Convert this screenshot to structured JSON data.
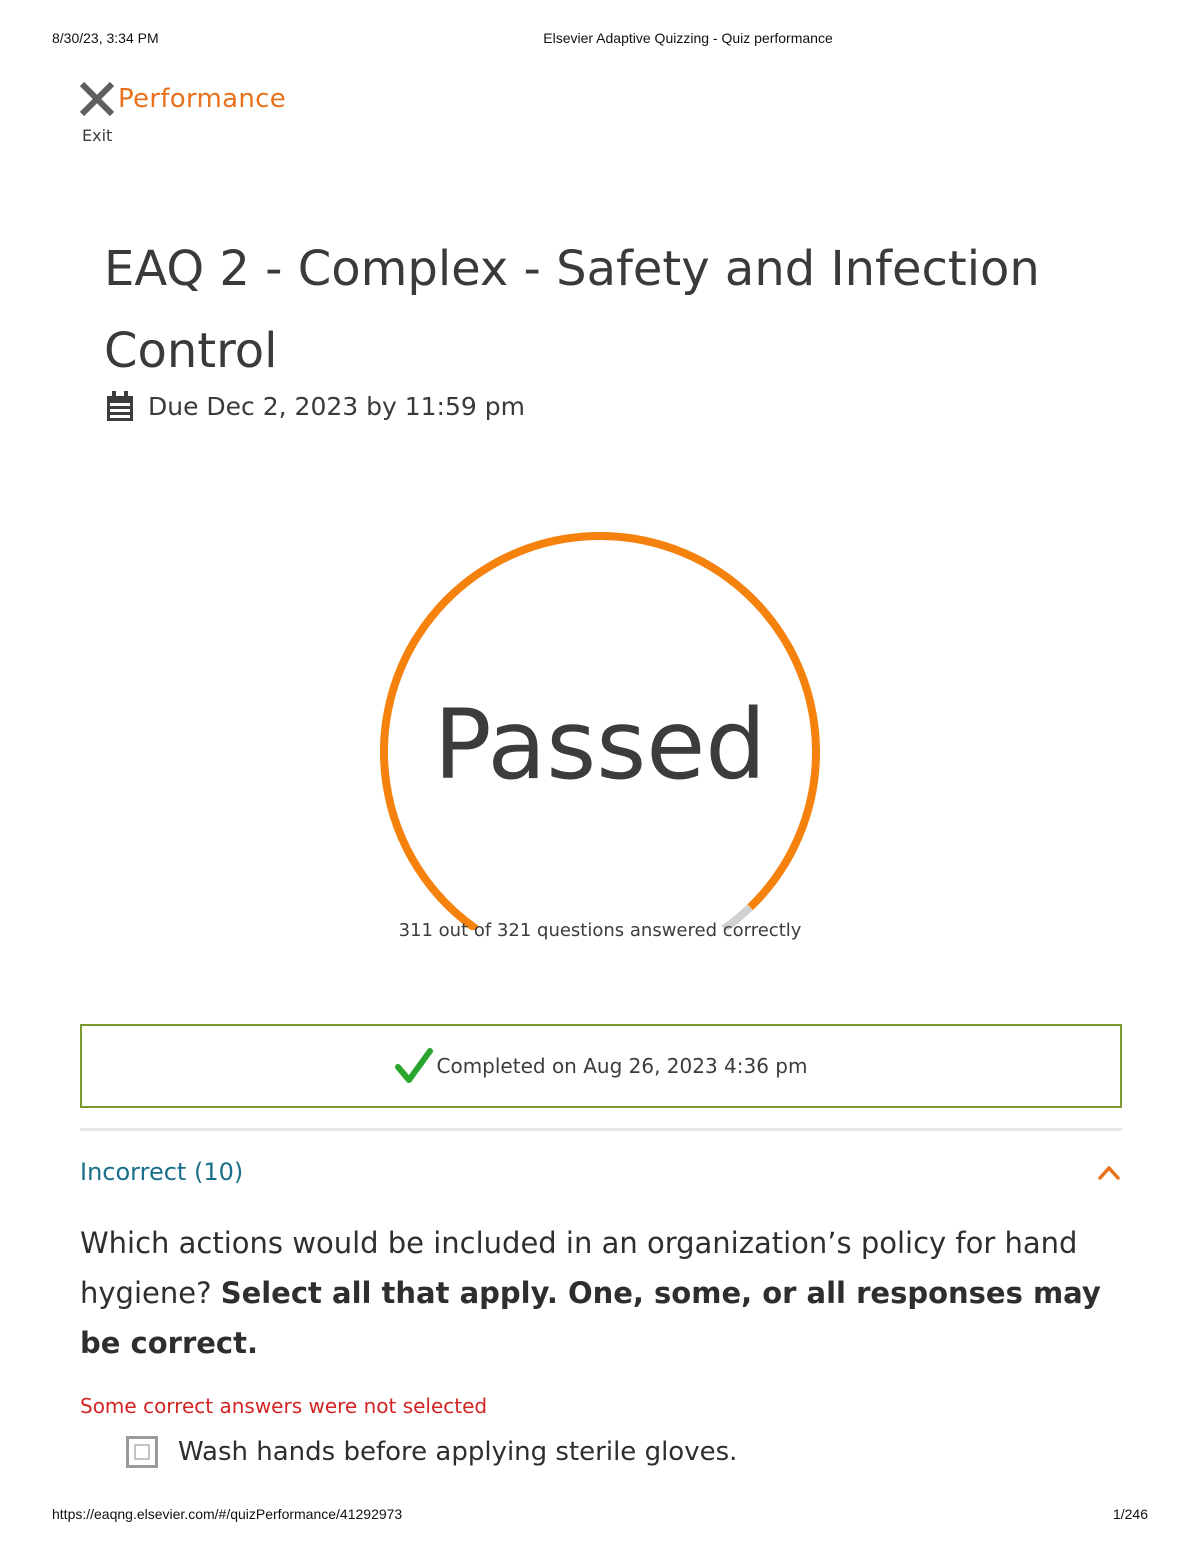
{
  "print_header": {
    "datetime": "8/30/23, 3:34 PM",
    "doc_title": "Elsevier Adaptive Quizzing - Quiz performance"
  },
  "print_footer": {
    "url": "https://eaqng.elsevier.com/#/quizPerformance/41292973",
    "page": "1/246"
  },
  "topbar": {
    "exit_label": "Exit",
    "exit_icon": "close-icon",
    "page_title": "Performance"
  },
  "quiz": {
    "title": "EAQ 2 - Complex - Safety and Infection Control",
    "due": "Due Dec 2, 2023 by 11:59 pm",
    "due_icon": "calendar-icon"
  },
  "result": {
    "status": "Passed",
    "caption": "311 out of 321 questions answered correctly",
    "correct": 311,
    "total": 321
  },
  "completion": {
    "text": "Completed on Aug 26, 2023 4:36 pm",
    "icon": "check-icon"
  },
  "section": {
    "title": "Incorrect (10)",
    "toggle_icon": "chevron-up-icon"
  },
  "question": {
    "prompt": "Which actions would be included in an organization’s policy for hand hygiene?",
    "instruction": "Select all that apply. One, some, or all responses may be correct.",
    "feedback": "Some correct answers were not selected",
    "answers": [
      {
        "text": "Wash hands before applying sterile gloves.",
        "selected": false
      }
    ]
  },
  "colors": {
    "accent_orange": "#f5820d",
    "title_orange": "#e9711c",
    "remaining_gray": "#d1d1d1",
    "success_border": "#7b9a2e",
    "check_green": "#2aa52e",
    "section_teal": "#1a6f8a",
    "error_red": "#d32424"
  }
}
